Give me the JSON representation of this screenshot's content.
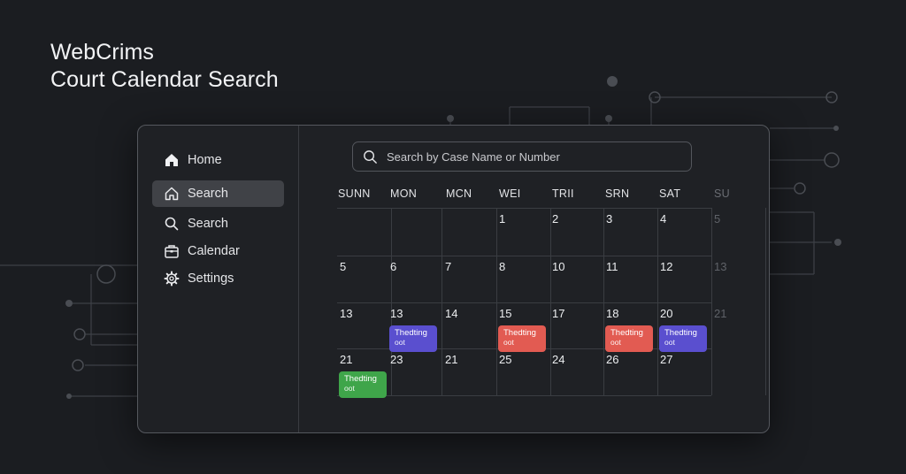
{
  "hero": {
    "line1": "WebCrims",
    "line2": "Court Calendar Search"
  },
  "sidebar": {
    "items": [
      {
        "label": "Home",
        "icon": "home-icon",
        "active": false
      },
      {
        "label": "Search",
        "icon": "home-outline-icon",
        "active": true
      },
      {
        "label": "Search",
        "icon": "search-icon",
        "active": false
      },
      {
        "label": "Calendar",
        "icon": "calendar-icon",
        "active": false
      },
      {
        "label": "Settings",
        "icon": "gear-icon",
        "active": false
      }
    ]
  },
  "search": {
    "placeholder": "Search by Case Name or Number",
    "value": ""
  },
  "calendar": {
    "weekdays": [
      "SUNN",
      "MON",
      "MCN",
      "WEI",
      "TRII",
      "SRN",
      "SAT",
      "SU"
    ],
    "weeks": [
      [
        "",
        "",
        "",
        "1",
        "2",
        "3",
        "4",
        "5"
      ],
      [
        "5",
        "6",
        "7",
        "8",
        "10",
        "11",
        "12",
        "13"
      ],
      [
        "13",
        "13",
        "14",
        "15",
        "17",
        "18",
        "20",
        "21"
      ],
      [
        "21",
        "23",
        "21",
        "25",
        "24",
        "26",
        "27",
        ""
      ]
    ],
    "events": [
      {
        "week": 2,
        "day": 1,
        "line1": "Thedting",
        "line2": "oot",
        "color": "#5a4fcf"
      },
      {
        "week": 2,
        "day": 3,
        "line1": "Thedting",
        "line2": "oot",
        "color": "#e25b52"
      },
      {
        "week": 2,
        "day": 5,
        "line1": "Thedting",
        "line2": "oot",
        "color": "#e25b52"
      },
      {
        "week": 2,
        "day": 6,
        "line1": "Thedting",
        "line2": "oot",
        "color": "#5a4fcf"
      },
      {
        "week": 3,
        "day": 0,
        "line1": "Thedting",
        "line2": "oot",
        "color": "#3fa54a"
      }
    ]
  },
  "colors": {
    "background": "#1b1d21",
    "panel": "#1f2125",
    "active_item": "#404247",
    "event_purple": "#5a4fcf",
    "event_red": "#e25b52",
    "event_green": "#3fa54a"
  }
}
